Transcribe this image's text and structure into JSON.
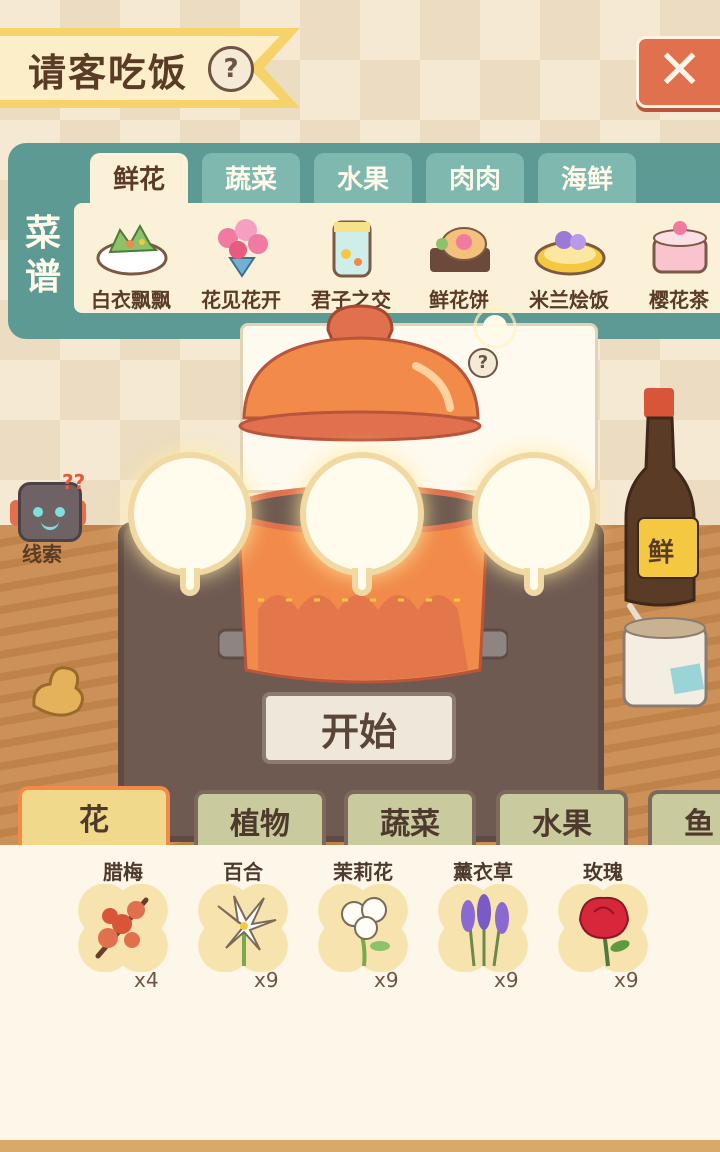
{
  "header": {
    "title": "请客吃饭",
    "help_icon": "?",
    "close_icon": "✕"
  },
  "recipe_panel": {
    "side_label_1": "菜",
    "side_label_2": "谱",
    "tabs": [
      "鲜花",
      "蔬菜",
      "水果",
      "肉肉",
      "海鲜"
    ],
    "active_tab": "鲜花",
    "recipes": [
      "白衣飘飘",
      "花见花开",
      "君子之交",
      "鲜花饼",
      "米兰烩饭",
      "樱花茶"
    ]
  },
  "note_help_icon": "?",
  "cooking": {
    "start_label": "开始",
    "empty_slots": 3
  },
  "clue": {
    "label": "线索",
    "marks": "??"
  },
  "bottle_label": "鲜",
  "ingredient_tabs": [
    "花",
    "植物",
    "蔬菜",
    "水果",
    "鱼"
  ],
  "active_ingredient_tab": "花",
  "ingredients": [
    {
      "name": "腊梅",
      "count": "x4",
      "icon": "wintersweet-icon"
    },
    {
      "name": "百合",
      "count": "x9",
      "icon": "lily-icon"
    },
    {
      "name": "茉莉花",
      "count": "x9",
      "icon": "jasmine-icon"
    },
    {
      "name": "薰衣草",
      "count": "x9",
      "icon": "lavender-icon"
    },
    {
      "name": "玫瑰",
      "count": "x9",
      "icon": "rose-icon"
    }
  ]
}
